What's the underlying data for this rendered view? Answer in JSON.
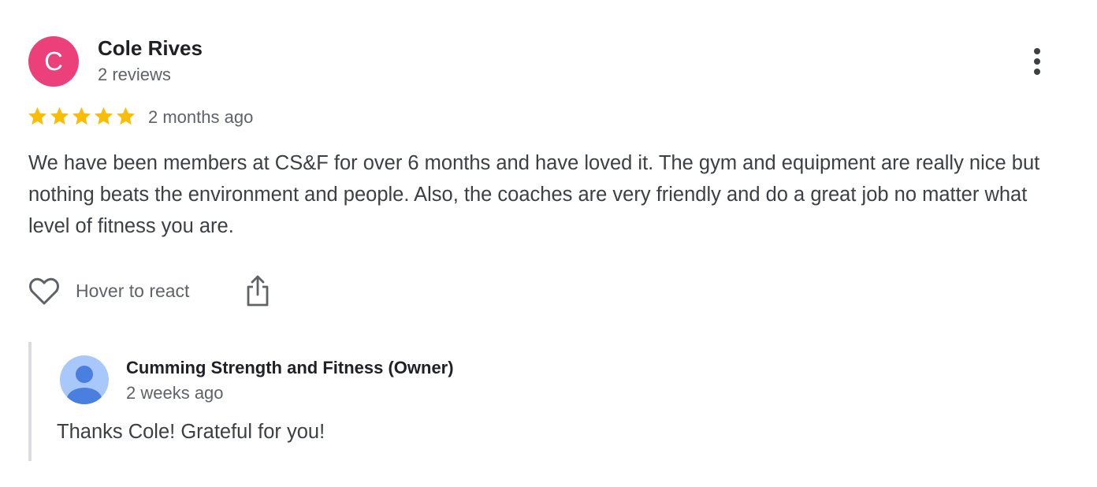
{
  "review": {
    "reviewer_initial": "C",
    "reviewer_name": "Cole Rives",
    "review_count": "2 reviews",
    "rating": 5,
    "rating_max": 5,
    "date": "2 months ago",
    "text": "We have been members at CS&F for over 6 months and have loved it. The gym and equipment are really nice but nothing beats the environment and people. Also, the coaches are very friendly and do a great job no matter what level of fitness you are.",
    "react_label": "Hover to react"
  },
  "owner_reply": {
    "name": "Cumming Strength and Fitness (Owner)",
    "date": "2 weeks ago",
    "text": "Thanks Cole! Grateful for you!"
  },
  "icons": {
    "more": "more-vert-icon",
    "star": "star-icon",
    "react": "heart-icon",
    "share": "share-icon",
    "owner_avatar": "person-icon"
  },
  "colors": {
    "avatar_bg": "#ec407a",
    "star": "#fbbc04",
    "owner_avatar_bg": "#a8c7fa",
    "owner_avatar_fg": "#4a7fe0",
    "reply_border": "#dadce0"
  }
}
